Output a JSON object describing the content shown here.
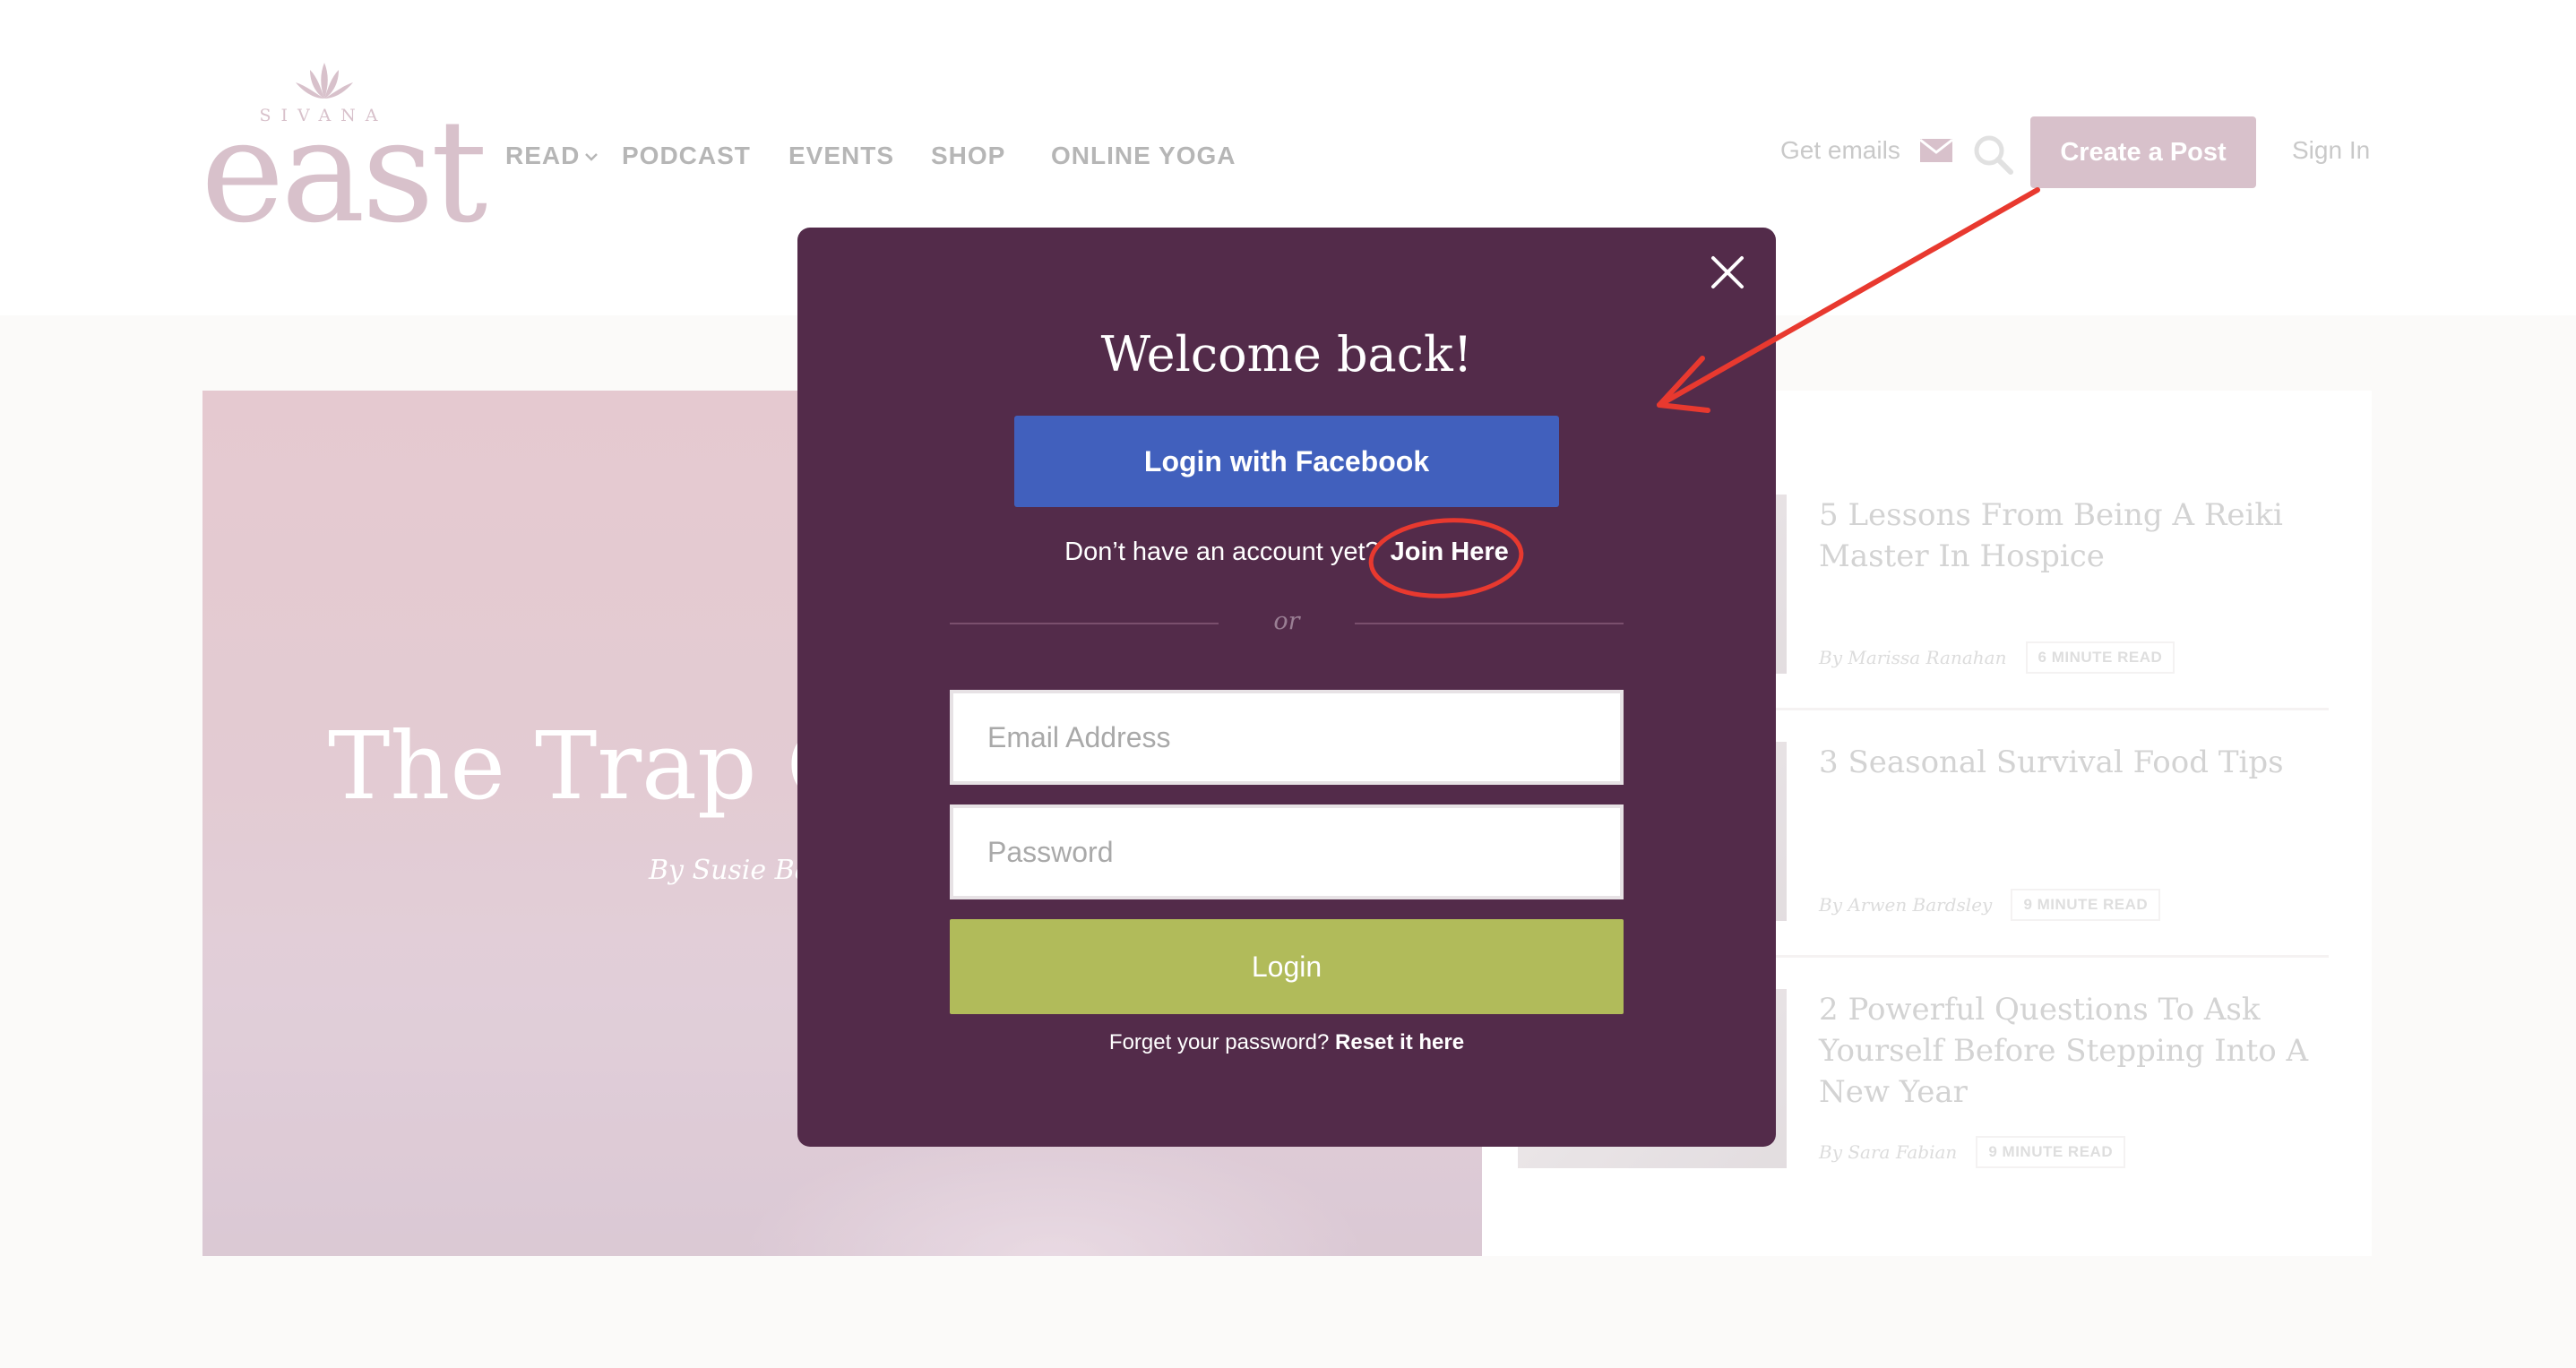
{
  "header": {
    "logo": {
      "tagline": "SIVANA",
      "brand": "east"
    },
    "nav": [
      {
        "label": "READ"
      },
      {
        "label": "PODCAST"
      },
      {
        "label": "EVENTS"
      },
      {
        "label": "SHOP"
      },
      {
        "label": "ONLINE YOGA"
      }
    ],
    "get_emails": "Get emails",
    "create_post": "Create a Post",
    "sign_in": "Sign In"
  },
  "hero": {
    "title": "The Trap Of",
    "byline": "By Susie Ba"
  },
  "articles": [
    {
      "title": "5 Lessons From Being A Reiki Master In Hospice",
      "author": "By Marissa Ranahan",
      "read_time": "6 MINUTE READ"
    },
    {
      "title": "3 Seasonal Survival Food Tips",
      "author": "By Arwen Bardsley",
      "read_time": "9 MINUTE READ"
    },
    {
      "title": "2 Powerful Questions To Ask Yourself Before Stepping Into A New Year",
      "author": "By Sara Fabian",
      "read_time": "9 MINUTE READ"
    }
  ],
  "modal": {
    "title": "Welcome back!",
    "facebook_label": "Login with Facebook",
    "no_account_text": "Don’t have an account yet?",
    "join_label": "Join Here",
    "or_label": "or",
    "email_placeholder": "Email Address",
    "password_placeholder": "Password",
    "login_label": "Login",
    "forgot_text": "Forget your password?",
    "reset_label": "Reset it here"
  },
  "colors": {
    "modal_bg": "#532b4a",
    "facebook": "#4160bd",
    "login": "#b1bb5a",
    "brand": "#c9aab8",
    "annotation": "#e8392f"
  }
}
